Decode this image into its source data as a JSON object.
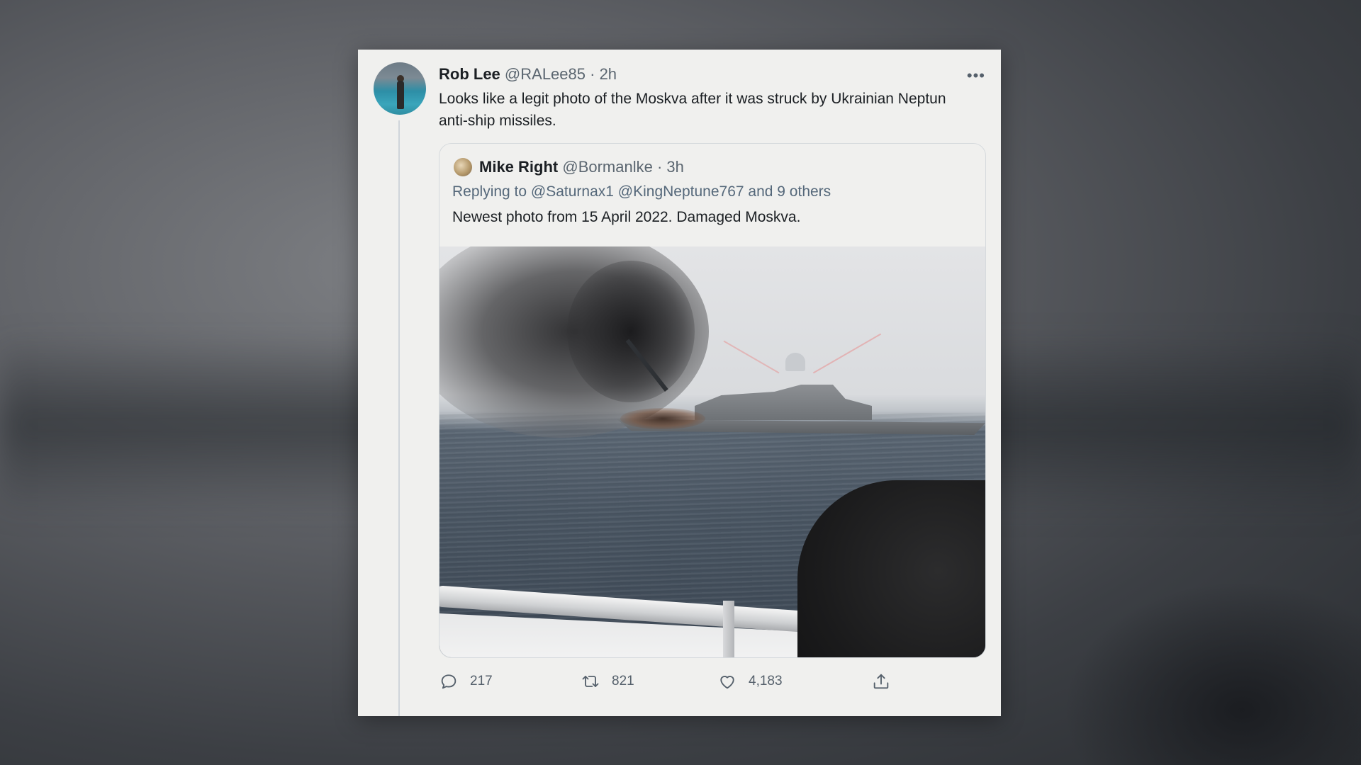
{
  "tweet": {
    "author_name": "Rob Lee",
    "author_handle": "@RALee85",
    "time": "· 2h",
    "text": "Looks like a legit photo of the Moskva after it was struck by Ukrainian Neptun anti-ship missiles.",
    "more_icon": "more-icon"
  },
  "quote": {
    "author_name": "Mike Right",
    "author_handle": "@Bormanlke",
    "time": "· 3h",
    "reply_prefix": "Replying to",
    "reply_mentions": "@Saturnax1 @KingNeptune767",
    "reply_suffix": "and 9 others",
    "text": "Newest photo from 15 April 2022. Damaged Moskva."
  },
  "actions": {
    "replies": "217",
    "retweets": "821",
    "likes": "4,183",
    "icons": [
      "reply-icon",
      "retweet-icon",
      "like-icon",
      "share-icon"
    ]
  },
  "colors": {
    "card_bg": "#f0f0ee",
    "muted_text": "#5b6670",
    "reply_link": "#55687a"
  }
}
